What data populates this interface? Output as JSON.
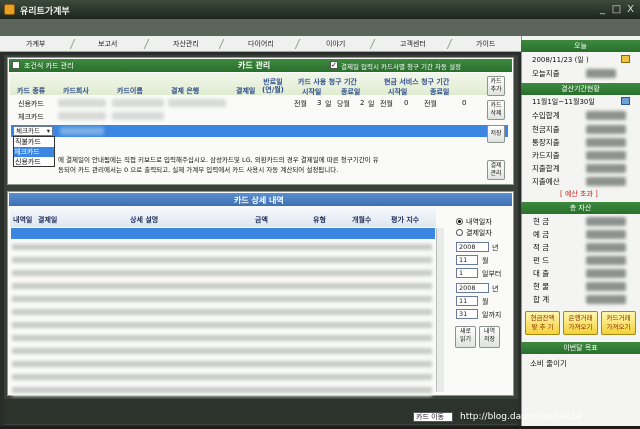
{
  "window": {
    "title": "유리트가계부",
    "min": "_",
    "max": "□",
    "close": "X"
  },
  "menu": [
    "가계부",
    "보고서",
    "자산관리",
    "다이어리",
    "이야기",
    "고객센터",
    "가이드"
  ],
  "card_mgmt": {
    "title": "카드 관리",
    "show_expired": "조건식 카드 관리",
    "auto_calc": "결제일 입력시 카드사별 청구 기간 자동 설정",
    "headers": {
      "type": "카드 종류",
      "company": "카드회사",
      "name": "카드이름",
      "bank": "결제 은행",
      "payday": "결제일",
      "cycle": "반료일\n(연/월)",
      "usage": "카드 사용 청구 기간",
      "cash": "현금 서비스 청구 기간",
      "start": "시작일",
      "end": "종료일",
      "start2": "시작일",
      "end2": "종료일"
    },
    "rows": [
      {
        "type": "신용카드"
      },
      {
        "type": "체크카드"
      },
      {
        "type": "체크카드"
      }
    ],
    "usage": {
      "a": "전월",
      "b": "3",
      "c": "일",
      "d": "당월",
      "e": "2",
      "f": "일",
      "g": "전월",
      "h": "0",
      "i": "전월",
      "j": "0"
    },
    "dropdown": [
      "직불카드",
      "체크카드",
      "신용카드"
    ],
    "note1": "에 결제일이 안내됨에는 직접 키보드로 입력해주십시오. 삼성카드및 LG, 외환카드의 경우 결제일에 따른 청구기간이 유",
    "note2": "동되어 카드 관리에서는 0 으로 출력되고, 실제 가계부 입력에서 카드 사용시 자동 계산되어 설정됩니다.",
    "buttons": {
      "add": "카드\n추가",
      "del": "카드\n삭제",
      "save": "저장",
      "pay": "결제\n관리"
    }
  },
  "detail": {
    "title": "카드 상세 내역",
    "cols": [
      "내역일",
      "결제일",
      "상세 설명",
      "금액",
      "유형",
      "개월수",
      "평가 지수"
    ],
    "radio_date": "내역일자",
    "radio_pay": "결제일자",
    "y1": "2008",
    "m1": "11",
    "d1": "1",
    "y2": "2008",
    "m2": "11",
    "d2": "31",
    "year": "년",
    "month": "월",
    "from": "일부터",
    "to": "일까지",
    "reload": "새로\n읽기",
    "save": "내역\n저장"
  },
  "right": {
    "today": "오늘",
    "date": "2008/11/23 (일 )",
    "today_exp": "오늘지출",
    "period": "결산기간현황",
    "range": "11월1일~11월30일",
    "items": [
      "수입합계",
      "현금지출",
      "통장지출",
      "카드지출",
      "지출합계",
      "지출예산"
    ],
    "over": "[ 예산 초과 ]",
    "assets": "총 자산",
    "asset_items": [
      "현 금",
      "예 금",
      "적 금",
      "펀 드",
      "대 출",
      "현 물",
      "합 계"
    ],
    "btn1": "현금잔액\n맞 추 기",
    "btn2": "은행거래\n가져오기",
    "btn3": "카드거래\n가져오기",
    "goal": "이번달 목표",
    "goal_text": "소비 줄이기"
  },
  "status": {
    "url": "http://blog.daum.net/ul424",
    "left": "카드 이동"
  }
}
